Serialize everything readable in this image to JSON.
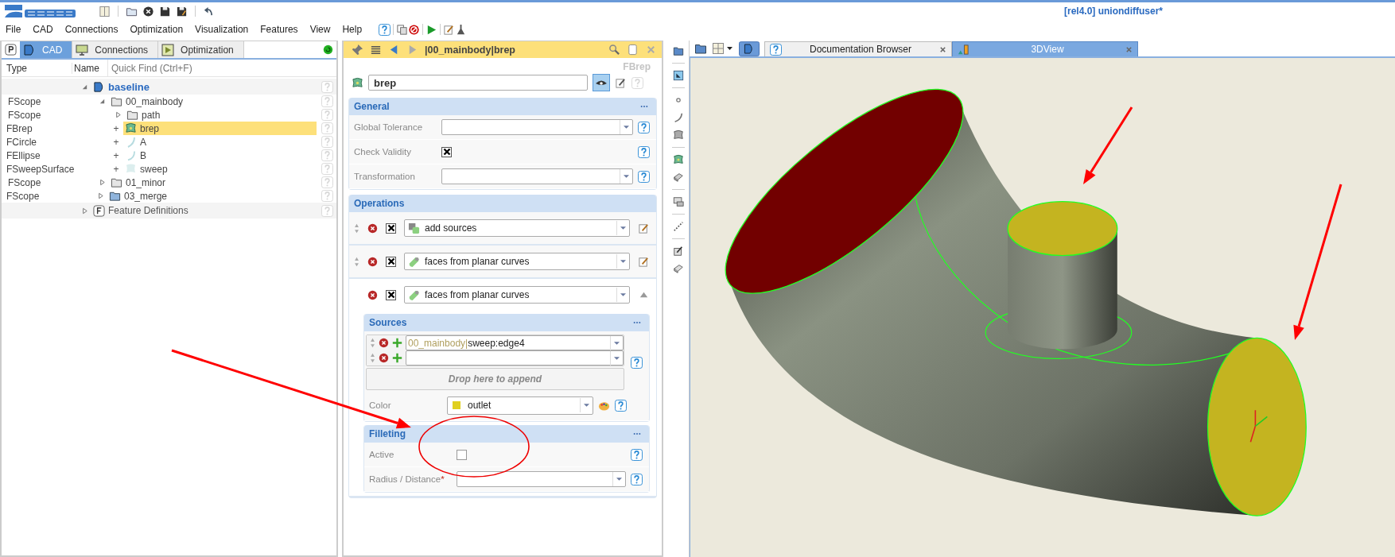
{
  "window": {
    "title": "[rel4.0] uniondiffuser*"
  },
  "menu": [
    "File",
    "CAD",
    "Connections",
    "Optimization",
    "Visualization",
    "Features",
    "View",
    "Help"
  ],
  "left_panel": {
    "tabs": [
      {
        "label": "CAD",
        "selected": true
      },
      {
        "label": "Connections",
        "selected": false
      },
      {
        "label": "Optimization",
        "selected": false
      }
    ],
    "columns": [
      "Type",
      "Name"
    ],
    "quick_find": {
      "placeholder": "Quick Find (Ctrl+F)"
    },
    "tree": [
      {
        "kind": "model",
        "name": "baseline",
        "expanded": true,
        "selected": false,
        "children": [
          {
            "kind": "scope",
            "type": "FScope",
            "name": "00_mainbody",
            "expanded": true,
            "selected": false,
            "children": [
              {
                "kind": "scope",
                "type": "FScope",
                "name": "path",
                "expanded": false,
                "selected": false
              },
              {
                "kind": "brep",
                "type": "FBrep",
                "name": "brep",
                "expander": "+",
                "selected": true
              },
              {
                "kind": "circle",
                "type": "FCircle",
                "name": "A",
                "expander": "+",
                "selected": false
              },
              {
                "kind": "ellipse",
                "type": "FEllipse",
                "name": "B",
                "expander": "+",
                "selected": false
              },
              {
                "kind": "sweep",
                "type": "FSweepSurface",
                "name": "sweep",
                "expander": "+",
                "selected": false
              }
            ]
          },
          {
            "kind": "scope",
            "type": "FScope",
            "name": "01_minor",
            "expanded": false,
            "selected": false
          },
          {
            "kind": "scope-merge",
            "type": "FScope",
            "name": "03_merge",
            "expanded": false,
            "selected": false
          }
        ]
      },
      {
        "kind": "definitions",
        "name": "Feature Definitions",
        "expanded": false,
        "selected": false
      }
    ]
  },
  "editor": {
    "path": "|00_mainbody|brep",
    "type_label": "FBrep",
    "name_field": {
      "value": "brep"
    },
    "general": {
      "title": "General",
      "rows": [
        {
          "kind": "combo",
          "label": "Global Tolerance"
        },
        {
          "kind": "checkbox",
          "label": "Check Validity",
          "checked": true
        },
        {
          "kind": "combo",
          "label": "Transformation"
        }
      ]
    },
    "operations": {
      "title": "Operations",
      "items": [
        {
          "kind": "sources",
          "name": "add sources",
          "checked": true,
          "expanded": false
        },
        {
          "kind": "faces",
          "name": "faces from planar curves",
          "checked": true,
          "expanded": false
        },
        {
          "kind": "faces",
          "name": "faces from planar curves",
          "checked": true,
          "expanded": true
        }
      ]
    },
    "sources": {
      "title": "Sources",
      "items": [
        {
          "kind": "entry",
          "scope": "00_mainbody|",
          "value": "sweep:edge4"
        },
        {
          "kind": "empty"
        }
      ],
      "drop_hint": "Drop here to append"
    },
    "color_row": {
      "label": "Color",
      "value": "outlet",
      "color": "#e0d020"
    },
    "filleting": {
      "title": "Filleting",
      "rows": [
        {
          "kind": "checkbox",
          "label": "Active",
          "checked": false
        },
        {
          "kind": "combo",
          "label": "Radius / Distance",
          "required_mark": "*"
        }
      ]
    }
  },
  "view": {
    "tabs": [
      {
        "label": "Documentation Browser",
        "selected": false
      },
      {
        "label": "3DView",
        "selected": true
      }
    ]
  }
}
